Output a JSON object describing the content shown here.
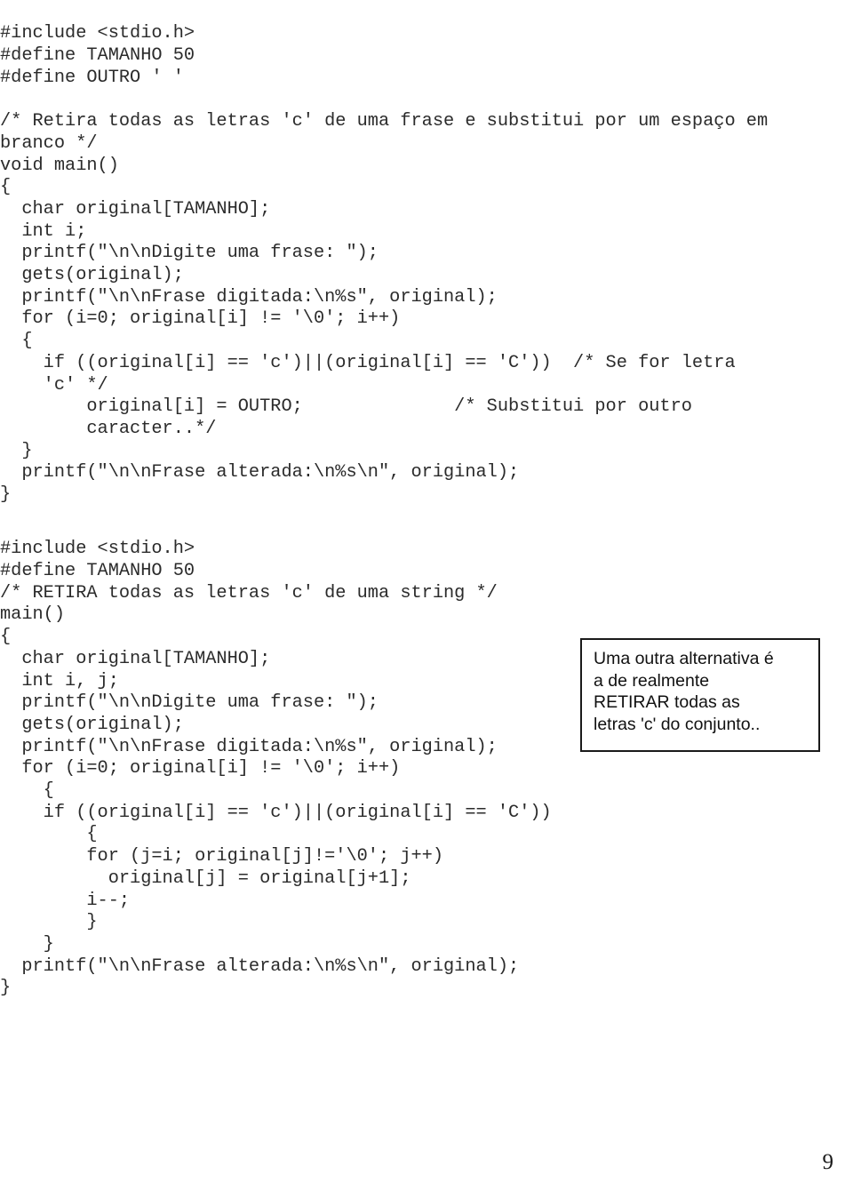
{
  "document": {
    "page_number": "9",
    "language": "C"
  },
  "code_block_1": {
    "name": "retira-letras-c-substitui-por-espaco",
    "lines": [
      "#include <stdio.h>",
      "#define TAMANHO 50",
      "#define OUTRO ' '",
      "",
      "/* Retira todas as letras 'c' de uma frase e substitui por um espaço em",
      "branco */",
      "void main()",
      "{",
      "  char original[TAMANHO];",
      "  int i;",
      "  printf(\"\\n\\nDigite uma frase: \");",
      "  gets(original);",
      "  printf(\"\\n\\nFrase digitada:\\n%s\", original);",
      "  for (i=0; original[i] != '\\0'; i++)",
      "  {",
      "    if ((original[i] == 'c')||(original[i] == 'C'))  /* Se for letra",
      "    'c' */",
      "        original[i] = OUTRO;              /* Substitui por outro",
      "        caracter..*/",
      "  }",
      "  printf(\"\\n\\nFrase alterada:\\n%s\\n\", original);",
      "}"
    ]
  },
  "code_block_2": {
    "name": "retira-letras-c-da-string",
    "lines": [
      "#include <stdio.h>",
      "#define TAMANHO 50",
      "/* RETIRA todas as letras 'c' de uma string */",
      "main()",
      "{",
      "  char original[TAMANHO];",
      "  int i, j;",
      "  printf(\"\\n\\nDigite uma frase: \");",
      "  gets(original);",
      "  printf(\"\\n\\nFrase digitada:\\n%s\", original);",
      "  for (i=0; original[i] != '\\0'; i++)",
      "    {",
      "    if ((original[i] == 'c')||(original[i] == 'C'))",
      "        {",
      "        for (j=i; original[j]!='\\0'; j++)",
      "          original[j] = original[j+1];",
      "        i--;",
      "        }",
      "    }",
      "  printf(\"\\n\\nFrase alterada:\\n%s\\n\", original);",
      "}"
    ]
  },
  "annotation": {
    "text": "Uma outra alternativa é\na de realmente\nRETIRAR todas as\nletras 'c' do conjunto.."
  }
}
